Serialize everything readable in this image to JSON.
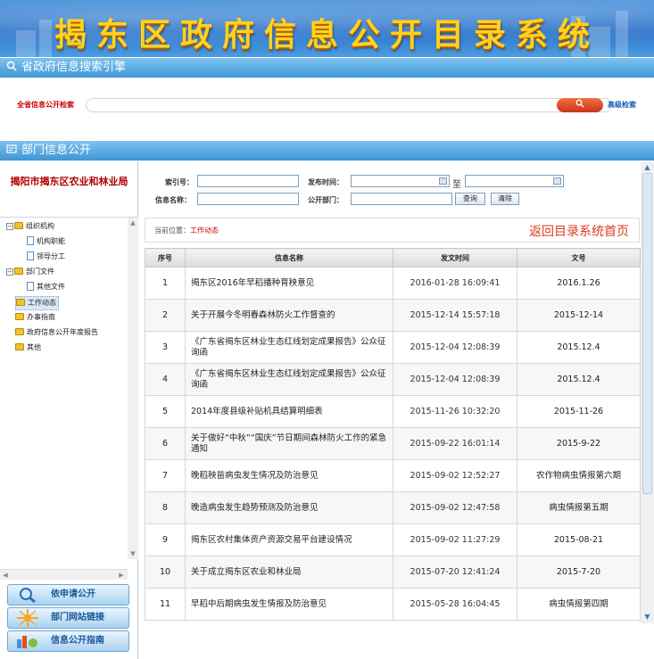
{
  "banner": {
    "title": "揭东区政府信息公开目录系统"
  },
  "province_bar": {
    "title": "省政府信息搜索引擎"
  },
  "search": {
    "label": "全省信息公开检索",
    "placeholder": "",
    "button_icon": "search-icon",
    "advanced_label": "高级检索"
  },
  "dept_bar": {
    "title": "部门信息公开"
  },
  "sidebar": {
    "dept_name": "揭阳市揭东区农业和林业局",
    "tree": [
      {
        "label": "组织机构",
        "kind": "folder",
        "expanded": true
      },
      {
        "label": "机构职能",
        "kind": "doc"
      },
      {
        "label": "领导分工",
        "kind": "doc"
      },
      {
        "label": "部门文件",
        "kind": "folder",
        "expanded": true
      },
      {
        "label": "其他文件",
        "kind": "doc"
      },
      {
        "label": "工作动态",
        "kind": "folder",
        "selected": true
      },
      {
        "label": "办事指南",
        "kind": "folder"
      },
      {
        "label": "政府信息公开年度报告",
        "kind": "folder"
      },
      {
        "label": "其他",
        "kind": "folder"
      }
    ],
    "nav_buttons": [
      {
        "label": "依申请公开",
        "icon": "magnifier-icon"
      },
      {
        "label": "部门网站链接",
        "icon": "network-link-icon"
      },
      {
        "label": "信息公开指南",
        "icon": "guide-icon"
      }
    ]
  },
  "filter": {
    "index_label": "索引号：",
    "date_label": "发布时间：",
    "to_label": "至",
    "name_label": "信息名称：",
    "dept_label": "公开部门：",
    "query_button": "查询",
    "clear_button": "清除"
  },
  "location": {
    "label": "当前位置：",
    "current": "工作动态",
    "home_link": "返回目录系统首页"
  },
  "table": {
    "headers": [
      "序号",
      "信息名称",
      "发文时间",
      "文号"
    ],
    "rows": [
      {
        "no": "1",
        "title": "揭东区2016年早稻播种育秧意见",
        "date": "2016-01-28 16:09:41",
        "doc_no": "2016.1.26"
      },
      {
        "no": "2",
        "title": "关于开展今冬明春森林防火工作督查的",
        "date": "2015-12-14 15:57:18",
        "doc_no": "2015-12-14"
      },
      {
        "no": "3",
        "title": "《广东省揭东区林业生态红线划定成果报告》公众征询函",
        "date": "2015-12-04 12:08:39",
        "doc_no": "2015.12.4"
      },
      {
        "no": "4",
        "title": "《广东省揭东区林业生态红线划定成果报告》公众征询函",
        "date": "2015-12-04 12:08:39",
        "doc_no": "2015.12.4"
      },
      {
        "no": "5",
        "title": "2014年度县级补贴机具结算明细表",
        "date": "2015-11-26 10:32:20",
        "doc_no": "2015-11-26"
      },
      {
        "no": "6",
        "title": "关于做好“中秋”“国庆”节日期间森林防火工作的紧急通知",
        "date": "2015-09-22 16:01:14",
        "doc_no": "2015-9-22"
      },
      {
        "no": "7",
        "title": "晚稻秧苗病虫发生情况及防治意见",
        "date": "2015-09-02 12:52:27",
        "doc_no": "农作物病虫情报第六期"
      },
      {
        "no": "8",
        "title": "晚造病虫发生趋势预测及防治意见",
        "date": "2015-09-02 12:47:58",
        "doc_no": "病虫情报第五期"
      },
      {
        "no": "9",
        "title": "揭东区农村集体资产资源交易平台建设情况",
        "date": "2015-09-02 11:27:29",
        "doc_no": "2015-08-21"
      },
      {
        "no": "10",
        "title": "关于成立揭东区农业和林业局",
        "date": "2015-07-20 12:41:24",
        "doc_no": "2015-7-20"
      },
      {
        "no": "11",
        "title": "早稻中后期病虫发生情报及防治意见",
        "date": "2015-05-28 16:04:45",
        "doc_no": "病虫情报第四期"
      }
    ]
  },
  "colors": {
    "banner_title": "#ffd21f",
    "bar": "#3f96d6",
    "dept_name": "#b00000",
    "home_link": "#e03a1a"
  }
}
